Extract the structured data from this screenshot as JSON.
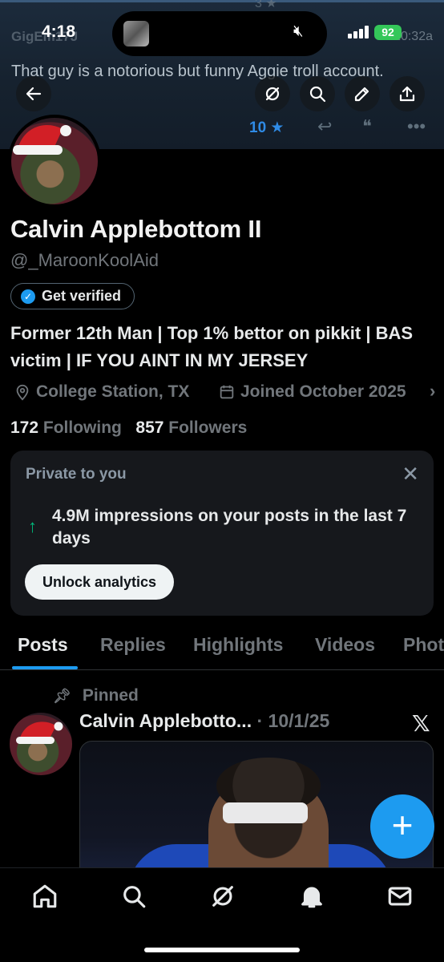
{
  "status_bar": {
    "time": "4:18",
    "battery": "92"
  },
  "banner": {
    "ghost_name": "GigEm17J",
    "ghost_time": "10:32a",
    "ghost_stars": "3 ★",
    "tweet_text": "That guy is a notorious but funny Aggie troll account.",
    "star_count": "10 ★"
  },
  "profile": {
    "name": "Calvin Applebottom II",
    "handle": "@_MaroonKoolAid",
    "verify_label": "Get verified",
    "bio": "Former 12th Man | Top 1% bettor on pikkit | BAS victim | IF YOU AINT IN MY JERSEY",
    "location": "College Station, TX",
    "joined": "Joined October 2025",
    "following_count": "172",
    "following_label": "Following",
    "followers_count": "857",
    "followers_label": "Followers"
  },
  "private_card": {
    "title": "Private to you",
    "impressions": "4.9M impressions on your posts in the last 7 days",
    "button": "Unlock analytics"
  },
  "tabs": [
    "Posts",
    "Replies",
    "Highlights",
    "Videos",
    "Photos"
  ],
  "active_tab": "Posts",
  "pinned_post": {
    "pinned_label": "Pinned",
    "author": "Calvin Applebotto...",
    "date": "· 10/1/25"
  },
  "colors": {
    "accent": "#1d9bf0",
    "background": "#000000",
    "secondary_text": "#71767b",
    "success": "#00ba7c"
  },
  "icons": [
    "back-arrow-icon",
    "grok-icon",
    "search-icon",
    "edit-icon",
    "share-icon",
    "location-pin-icon",
    "calendar-icon",
    "close-icon",
    "arrow-up-icon",
    "pin-icon",
    "x-logo-icon",
    "plus-icon",
    "home-icon",
    "notifications-bell-icon",
    "mail-icon"
  ]
}
